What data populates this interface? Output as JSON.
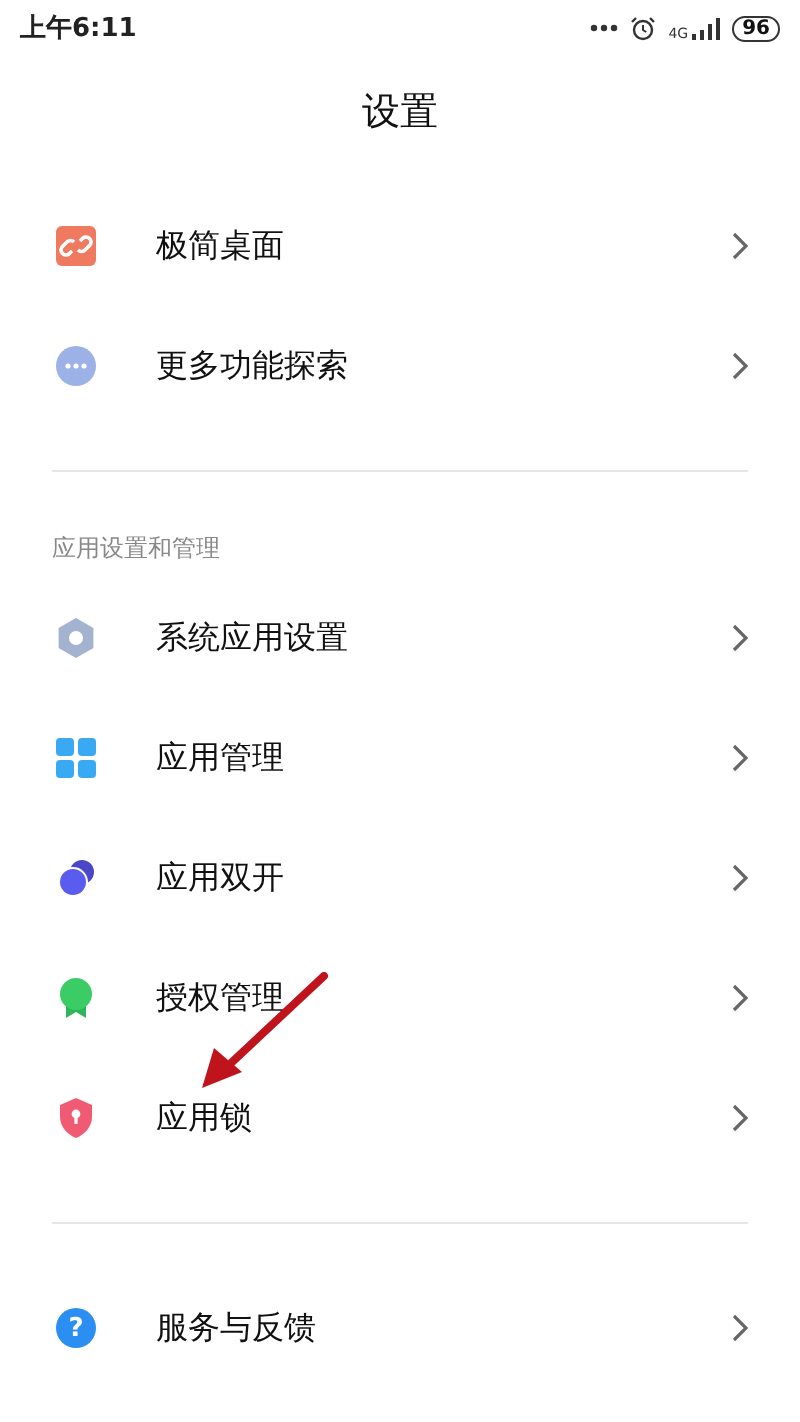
{
  "status_bar": {
    "time": "上午6:11",
    "network": "4G",
    "battery": "96"
  },
  "title": "设置",
  "groups": [
    {
      "items": [
        {
          "label": "极简桌面",
          "kind": "link"
        },
        {
          "label": "更多功能探索",
          "kind": "more"
        }
      ]
    },
    {
      "header": "应用设置和管理",
      "items": [
        {
          "label": "系统应用设置",
          "kind": "gear"
        },
        {
          "label": "应用管理",
          "kind": "grid"
        },
        {
          "label": "应用双开",
          "kind": "dual"
        },
        {
          "label": "授权管理",
          "kind": "badge"
        },
        {
          "label": "应用锁",
          "kind": "lock"
        }
      ]
    },
    {
      "items": [
        {
          "label": "服务与反馈",
          "kind": "help",
          "glyph": "?"
        }
      ]
    }
  ]
}
